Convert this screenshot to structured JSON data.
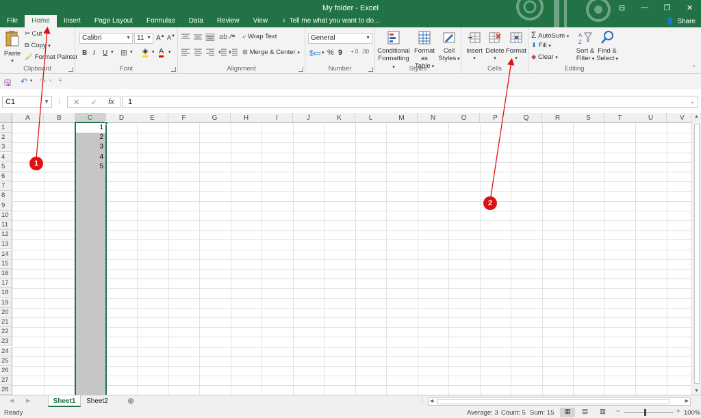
{
  "window": {
    "title": "My folder - Excel",
    "share_label": "Share"
  },
  "tabs": [
    "File",
    "Home",
    "Insert",
    "Page Layout",
    "Formulas",
    "Data",
    "Review",
    "View"
  ],
  "tell_me": "Tell me what you want to do...",
  "ribbon": {
    "clipboard": {
      "label": "Clipboard",
      "paste": "Paste",
      "cut": "Cut",
      "copy": "Copy",
      "format_painter": "Format Painter"
    },
    "font": {
      "label": "Font",
      "font_name": "Calibri",
      "font_size": "11",
      "bold": "B",
      "italic": "I",
      "underline": "U"
    },
    "alignment": {
      "label": "Alignment",
      "wrap_text": "Wrap Text",
      "merge_center": "Merge & Center"
    },
    "number": {
      "label": "Number",
      "format": "General",
      "percent": "%",
      "comma": "9"
    },
    "styles": {
      "label": "Styles",
      "conditional_1": "Conditional",
      "conditional_2": "Formatting",
      "format_as_1": "Format as",
      "format_as_2": "Table",
      "cell_styles_1": "Cell",
      "cell_styles_2": "Styles"
    },
    "cells": {
      "label": "Cells",
      "insert": "Insert",
      "delete": "Delete",
      "format": "Format"
    },
    "editing": {
      "label": "Editing",
      "autosum": "AutoSum",
      "fill": "Fill",
      "clear": "Clear",
      "sort_1": "Sort &",
      "sort_2": "Filter",
      "find_1": "Find &",
      "find_2": "Select"
    }
  },
  "formula_bar": {
    "name_box": "C1",
    "fx": "fx",
    "formula": "1"
  },
  "columns": [
    "A",
    "B",
    "C",
    "D",
    "E",
    "F",
    "G",
    "H",
    "I",
    "J",
    "K",
    "L",
    "M",
    "N",
    "O",
    "P",
    "Q",
    "R",
    "S",
    "T",
    "U",
    "V"
  ],
  "rows": [
    "1",
    "2",
    "3",
    "4",
    "5",
    "6",
    "7",
    "8",
    "9",
    "10",
    "11",
    "12",
    "13",
    "14",
    "15",
    "16",
    "17",
    "18",
    "19",
    "20",
    "21",
    "22",
    "23",
    "24",
    "25",
    "26",
    "27",
    "28"
  ],
  "selected_column": "C",
  "cells_c": [
    "1",
    "2",
    "3",
    "4",
    "5"
  ],
  "sheets": [
    "Sheet1",
    "Sheet2"
  ],
  "active_sheet": "Sheet1",
  "status": {
    "mode": "Ready",
    "average": "Average: 3",
    "count": "Count: 5",
    "sum": "Sum: 15",
    "zoom": "100%"
  },
  "annotations": [
    "1",
    "2"
  ],
  "colors": {
    "brand": "#217346",
    "annotation": "#e01010"
  }
}
